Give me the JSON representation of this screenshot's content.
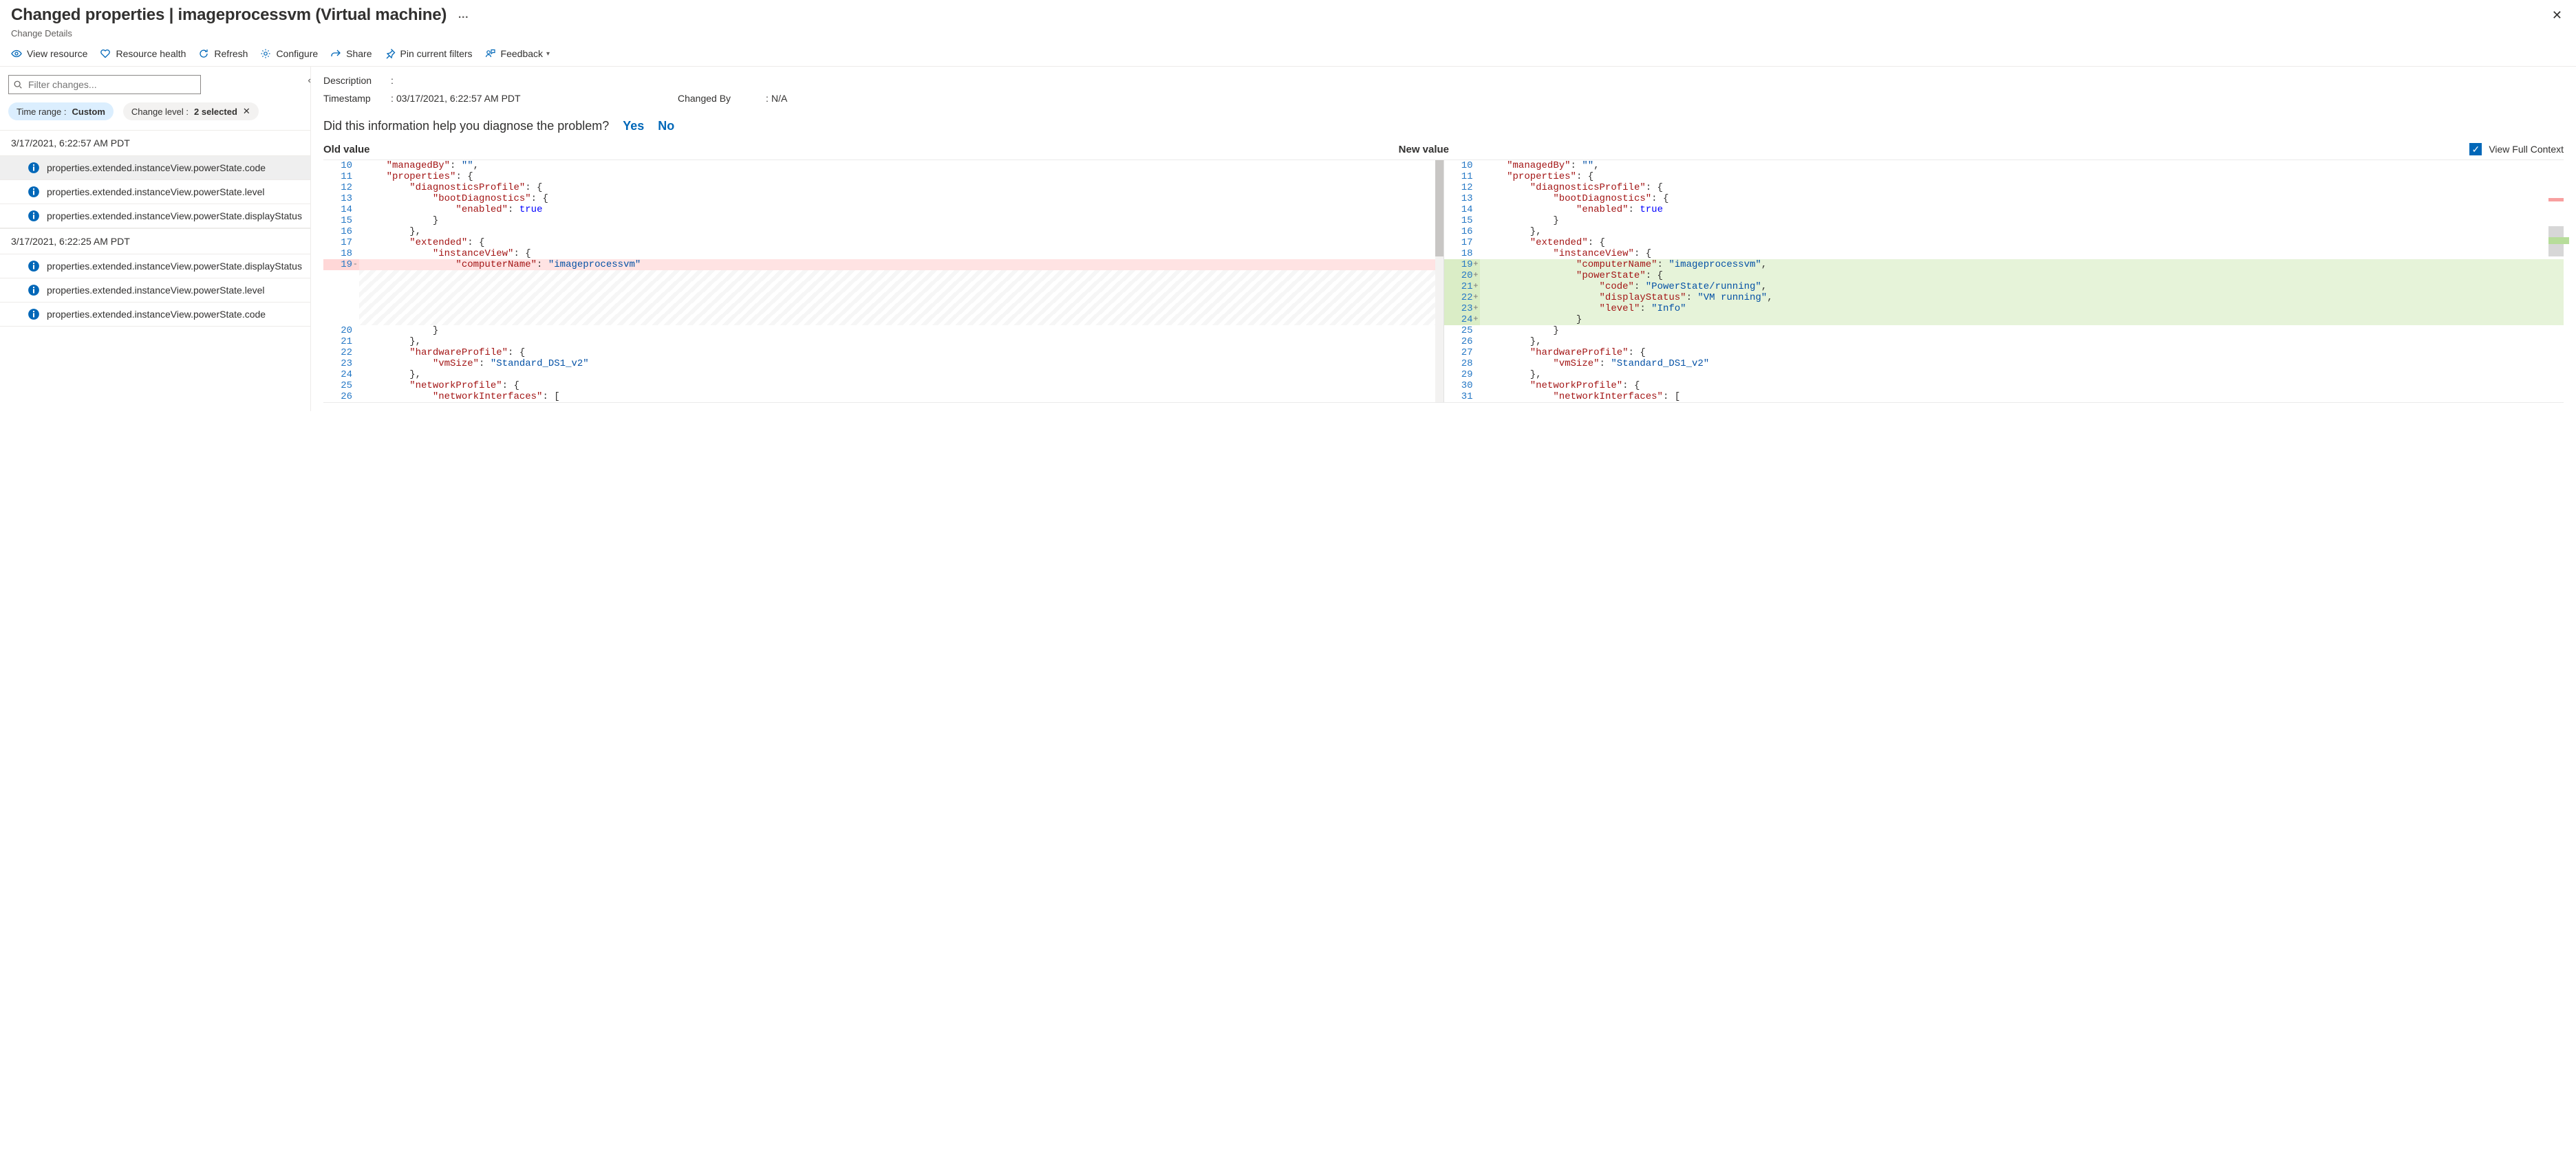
{
  "header": {
    "title": "Changed properties | imageprocessvm (Virtual machine)",
    "subtitle": "Change Details"
  },
  "toolbar": {
    "view_resource": "View resource",
    "resource_health": "Resource health",
    "refresh": "Refresh",
    "configure": "Configure",
    "share": "Share",
    "pin": "Pin current filters",
    "feedback": "Feedback"
  },
  "filter": {
    "placeholder": "Filter changes...",
    "time_range_label": "Time range : ",
    "time_range_value": "Custom",
    "change_level_label": "Change level : ",
    "change_level_value": "2 selected"
  },
  "groups": [
    {
      "time": "3/17/2021, 6:22:57 AM PDT",
      "rows": [
        "properties.extended.instanceView.powerState.code",
        "properties.extended.instanceView.powerState.level",
        "properties.extended.instanceView.powerState.displayStatus"
      ],
      "selected_index": 0
    },
    {
      "time": "3/17/2021, 6:22:25 AM PDT",
      "rows": [
        "properties.extended.instanceView.powerState.displayStatus",
        "properties.extended.instanceView.powerState.level",
        "properties.extended.instanceView.powerState.code"
      ]
    }
  ],
  "meta": {
    "description_lbl": "Description",
    "description_val": "",
    "timestamp_lbl": "Timestamp",
    "timestamp_val": "03/17/2021, 6:22:57 AM PDT",
    "changedby_lbl": "Changed By",
    "changedby_val": "N/A"
  },
  "feedback_q": "Did this information help you diagnose the problem?",
  "yes": "Yes",
  "no": "No",
  "diff_labels": {
    "old": "Old value",
    "new": "New value",
    "full_ctx": "View Full Context"
  },
  "diff": {
    "old": [
      {
        "n": 10,
        "tokens": [
          [
            "    ",
            ""
          ],
          [
            "\"managedBy\"",
            "key"
          ],
          [
            ": ",
            "punc"
          ],
          [
            "\"\"",
            "str"
          ],
          [
            ",",
            "punc"
          ]
        ]
      },
      {
        "n": 11,
        "tokens": [
          [
            "    ",
            ""
          ],
          [
            "\"properties\"",
            "key"
          ],
          [
            ": {",
            "punc"
          ]
        ]
      },
      {
        "n": 12,
        "tokens": [
          [
            "        ",
            ""
          ],
          [
            "\"diagnosticsProfile\"",
            "key"
          ],
          [
            ": {",
            "punc"
          ]
        ]
      },
      {
        "n": 13,
        "tokens": [
          [
            "            ",
            ""
          ],
          [
            "\"bootDiagnostics\"",
            "key"
          ],
          [
            ": {",
            "punc"
          ]
        ]
      },
      {
        "n": 14,
        "tokens": [
          [
            "                ",
            ""
          ],
          [
            "\"enabled\"",
            "key"
          ],
          [
            ": ",
            "punc"
          ],
          [
            "true",
            "bool"
          ]
        ]
      },
      {
        "n": 15,
        "tokens": [
          [
            "            }",
            "punc"
          ]
        ]
      },
      {
        "n": 16,
        "tokens": [
          [
            "        },",
            "punc"
          ]
        ]
      },
      {
        "n": 17,
        "tokens": [
          [
            "        ",
            ""
          ],
          [
            "\"extended\"",
            "key"
          ],
          [
            ": {",
            "punc"
          ]
        ]
      },
      {
        "n": 18,
        "tokens": [
          [
            "            ",
            ""
          ],
          [
            "\"instanceView\"",
            "key"
          ],
          [
            ": {",
            "punc"
          ]
        ]
      },
      {
        "n": 19,
        "cls": "del",
        "mark": "-",
        "tokens": [
          [
            "                ",
            ""
          ],
          [
            "\"computerName\"",
            "key"
          ],
          [
            ": ",
            "punc"
          ],
          [
            "\"imageprocessvm\"",
            "str"
          ]
        ]
      },
      {
        "gap": true
      },
      {
        "gap": true
      },
      {
        "gap": true
      },
      {
        "gap": true
      },
      {
        "gap": true
      },
      {
        "n": 20,
        "tokens": [
          [
            "            }",
            "punc"
          ]
        ]
      },
      {
        "n": 21,
        "tokens": [
          [
            "        },",
            "punc"
          ]
        ]
      },
      {
        "n": 22,
        "tokens": [
          [
            "        ",
            ""
          ],
          [
            "\"hardwareProfile\"",
            "key"
          ],
          [
            ": {",
            "punc"
          ]
        ]
      },
      {
        "n": 23,
        "tokens": [
          [
            "            ",
            ""
          ],
          [
            "\"vmSize\"",
            "key"
          ],
          [
            ": ",
            "punc"
          ],
          [
            "\"Standard_DS1_v2\"",
            "str"
          ]
        ]
      },
      {
        "n": 24,
        "tokens": [
          [
            "        },",
            "punc"
          ]
        ]
      },
      {
        "n": 25,
        "tokens": [
          [
            "        ",
            ""
          ],
          [
            "\"networkProfile\"",
            "key"
          ],
          [
            ": {",
            "punc"
          ]
        ]
      },
      {
        "n": 26,
        "tokens": [
          [
            "            ",
            ""
          ],
          [
            "\"networkInterfaces\"",
            "key"
          ],
          [
            ": [",
            "punc"
          ]
        ]
      }
    ],
    "new": [
      {
        "n": 10,
        "tokens": [
          [
            "    ",
            ""
          ],
          [
            "\"managedBy\"",
            "key"
          ],
          [
            ": ",
            "punc"
          ],
          [
            "\"\"",
            "str"
          ],
          [
            ",",
            "punc"
          ]
        ]
      },
      {
        "n": 11,
        "tokens": [
          [
            "    ",
            ""
          ],
          [
            "\"properties\"",
            "key"
          ],
          [
            ": {",
            "punc"
          ]
        ]
      },
      {
        "n": 12,
        "tokens": [
          [
            "        ",
            ""
          ],
          [
            "\"diagnosticsProfile\"",
            "key"
          ],
          [
            ": {",
            "punc"
          ]
        ]
      },
      {
        "n": 13,
        "tokens": [
          [
            "            ",
            ""
          ],
          [
            "\"bootDiagnostics\"",
            "key"
          ],
          [
            ": {",
            "punc"
          ]
        ]
      },
      {
        "n": 14,
        "tokens": [
          [
            "                ",
            ""
          ],
          [
            "\"enabled\"",
            "key"
          ],
          [
            ": ",
            "punc"
          ],
          [
            "true",
            "bool"
          ]
        ]
      },
      {
        "n": 15,
        "tokens": [
          [
            "            }",
            "punc"
          ]
        ]
      },
      {
        "n": 16,
        "tokens": [
          [
            "        },",
            "punc"
          ]
        ]
      },
      {
        "n": 17,
        "tokens": [
          [
            "        ",
            ""
          ],
          [
            "\"extended\"",
            "key"
          ],
          [
            ": {",
            "punc"
          ]
        ]
      },
      {
        "n": 18,
        "tokens": [
          [
            "            ",
            ""
          ],
          [
            "\"instanceView\"",
            "key"
          ],
          [
            ": {",
            "punc"
          ]
        ]
      },
      {
        "n": 19,
        "cls": "add",
        "mark": "+",
        "tokens": [
          [
            "                ",
            ""
          ],
          [
            "\"computerName\"",
            "key"
          ],
          [
            ": ",
            "punc"
          ],
          [
            "\"imageprocessvm\"",
            "str"
          ],
          [
            ",",
            "punc"
          ]
        ]
      },
      {
        "n": 20,
        "cls": "add",
        "mark": "+",
        "tokens": [
          [
            "                ",
            ""
          ],
          [
            "\"powerState\"",
            "key"
          ],
          [
            ": {",
            "punc"
          ]
        ]
      },
      {
        "n": 21,
        "cls": "add",
        "mark": "+",
        "tokens": [
          [
            "                    ",
            ""
          ],
          [
            "\"code\"",
            "key"
          ],
          [
            ": ",
            "punc"
          ],
          [
            "\"PowerState/running\"",
            "str"
          ],
          [
            ",",
            "punc"
          ]
        ]
      },
      {
        "n": 22,
        "cls": "add",
        "mark": "+",
        "tokens": [
          [
            "                    ",
            ""
          ],
          [
            "\"displayStatus\"",
            "key"
          ],
          [
            ": ",
            "punc"
          ],
          [
            "\"VM running\"",
            "str"
          ],
          [
            ",",
            "punc"
          ]
        ]
      },
      {
        "n": 23,
        "cls": "add",
        "mark": "+",
        "tokens": [
          [
            "                    ",
            ""
          ],
          [
            "\"level\"",
            "key"
          ],
          [
            ": ",
            "punc"
          ],
          [
            "\"Info\"",
            "str"
          ]
        ]
      },
      {
        "n": 24,
        "cls": "add",
        "mark": "+",
        "tokens": [
          [
            "                }",
            "punc"
          ]
        ]
      },
      {
        "n": 25,
        "tokens": [
          [
            "            }",
            "punc"
          ]
        ]
      },
      {
        "n": 26,
        "tokens": [
          [
            "        },",
            "punc"
          ]
        ]
      },
      {
        "n": 27,
        "tokens": [
          [
            "        ",
            ""
          ],
          [
            "\"hardwareProfile\"",
            "key"
          ],
          [
            ": {",
            "punc"
          ]
        ]
      },
      {
        "n": 28,
        "tokens": [
          [
            "            ",
            ""
          ],
          [
            "\"vmSize\"",
            "key"
          ],
          [
            ": ",
            "punc"
          ],
          [
            "\"Standard_DS1_v2\"",
            "str"
          ]
        ]
      },
      {
        "n": 29,
        "tokens": [
          [
            "        },",
            "punc"
          ]
        ]
      },
      {
        "n": 30,
        "tokens": [
          [
            "        ",
            ""
          ],
          [
            "\"networkProfile\"",
            "key"
          ],
          [
            ": {",
            "punc"
          ]
        ]
      },
      {
        "n": 31,
        "tokens": [
          [
            "            ",
            ""
          ],
          [
            "\"networkInterfaces\"",
            "key"
          ],
          [
            ": [",
            "punc"
          ]
        ]
      }
    ]
  }
}
